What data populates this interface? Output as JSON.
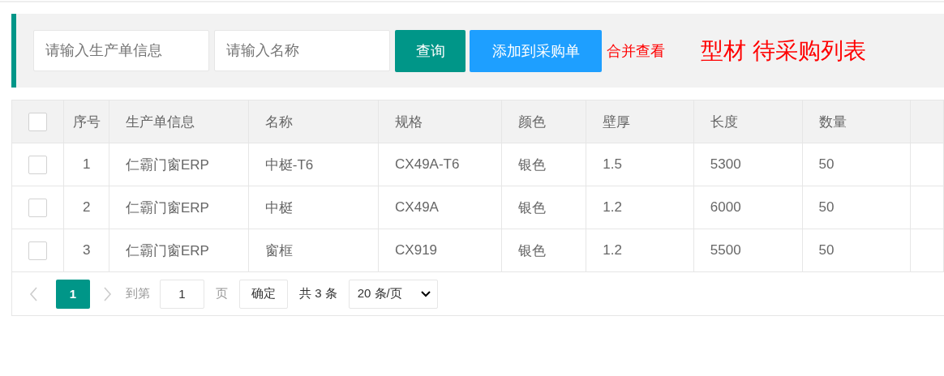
{
  "toolbar": {
    "fields": [
      {
        "placeholder": "请输入生产单信息"
      },
      {
        "placeholder": "请输入名称"
      }
    ],
    "buttons": [
      {
        "label": "查询",
        "kind": "primary"
      },
      {
        "label": "添加到采购单",
        "kind": "normal"
      }
    ],
    "link": "合并查看",
    "title": "型材 待采购列表"
  },
  "table": {
    "columns": [
      "序号",
      "生产单信息",
      "名称",
      "规格",
      "颜色",
      "壁厚",
      "长度",
      "数量"
    ],
    "all_checked": false,
    "rows": [
      {
        "checked": false,
        "cells": [
          "1",
          "仁霸门窗ERP",
          "中梃-T6",
          "CX49A-T6",
          "银色",
          "1.5",
          "5300",
          "50"
        ]
      },
      {
        "checked": false,
        "cells": [
          "2",
          "仁霸门窗ERP",
          "中梃",
          "CX49A",
          "银色",
          "1.2",
          "6000",
          "50"
        ]
      },
      {
        "checked": false,
        "cells": [
          "3",
          "仁霸门窗ERP",
          "窗框",
          "CX919",
          "银色",
          "1.2",
          "5500",
          "50"
        ]
      }
    ]
  },
  "pagination": {
    "pages": [
      {
        "label": "1",
        "selected": true
      }
    ],
    "goto_label": "到第",
    "goto_value": "1",
    "page_unit": "页",
    "confirm": "确定",
    "total": "共 3 条",
    "page_size": "20 条/页"
  }
}
